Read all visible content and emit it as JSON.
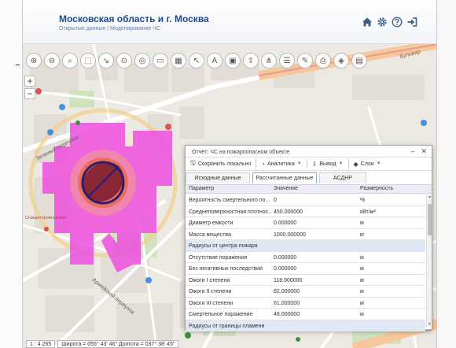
{
  "header": {
    "title": "Московская область и г. Москва",
    "subtitle": "Открытые данные | Моделирование ЧС",
    "icons": [
      "home-icon",
      "gear-icon",
      "help-icon",
      "logout-icon"
    ]
  },
  "map": {
    "street_labels": [
      "Зеленый переулок",
      "Армейский переулок",
      "Бульвар"
    ],
    "marker_label": "Станция Кремлевская"
  },
  "status": {
    "scale": "1 : 4 265",
    "coords": "Широта = 055° 43' 46\"  Долгота = 037° 38' 45\""
  },
  "dialog": {
    "title": "Отчёт: ЧС на пожароопасном объекте.",
    "buttons": {
      "save": "Сохранить локально",
      "analytics": "Аналитика",
      "output": "Вывод",
      "layers": "Слои"
    },
    "tabs": [
      "Исходные данные",
      "Рассчитанные данные",
      "АСДНР"
    ],
    "columns": [
      "Параметр",
      "Значение",
      "Размерность"
    ],
    "rows": [
      {
        "param": "Вероятность смертельного по...",
        "value": "0",
        "unit": "%"
      },
      {
        "param": "Среднеповерхностная плотнос...",
        "value": "450.000000",
        "unit": "кВт/м²"
      },
      {
        "param": "Диаметр емкости",
        "value": "0.000000",
        "unit": "м"
      },
      {
        "param": "Масса вещества",
        "value": "1000.000000",
        "unit": "кг"
      },
      {
        "param": "Радиусы от центра пожара",
        "value": "",
        "unit": ""
      },
      {
        "param": "Отсутствие поражения",
        "value": "0.000000",
        "unit": "м"
      },
      {
        "param": "Без негативных последствий",
        "value": "0.000000",
        "unit": "м"
      },
      {
        "param": "Ожоги I степени",
        "value": "118.000000",
        "unit": "м"
      },
      {
        "param": "Ожоги II степени",
        "value": "82.000000",
        "unit": "м"
      },
      {
        "param": "Ожоги III степени",
        "value": "61.000000",
        "unit": "м"
      },
      {
        "param": "Смертельное поражение",
        "value": "48.000000",
        "unit": "м"
      },
      {
        "param": "Радиусы от границы пламени",
        "value": "",
        "unit": ""
      }
    ]
  },
  "colors": {
    "accent": "#1f4a86",
    "zone_magenta": "#ee4fe0",
    "zone_core": "#7d2235"
  }
}
